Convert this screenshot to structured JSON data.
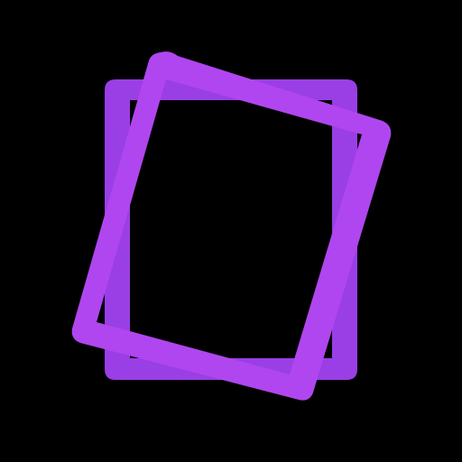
{
  "icon": {
    "name": "tilted-frames-icon",
    "background_color": "#000000",
    "back_frame_color": "#9a3ee6",
    "front_frame_color": "#b046ef"
  }
}
